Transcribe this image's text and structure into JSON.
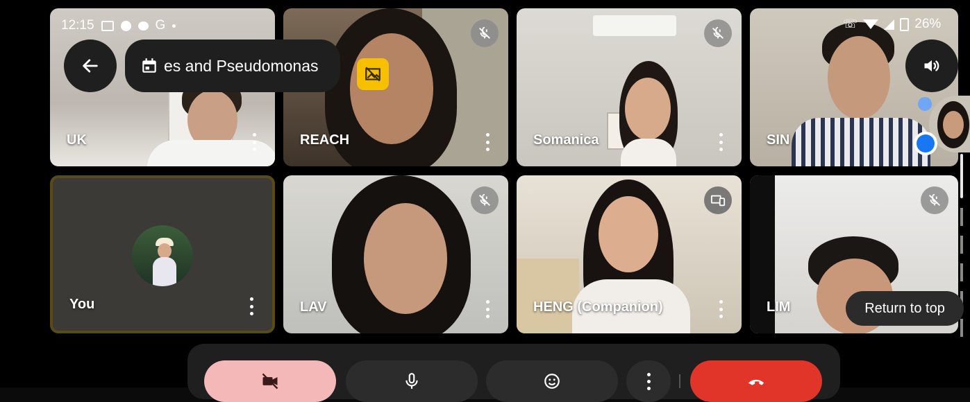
{
  "status_bar": {
    "time": "12:15",
    "battery": "26%",
    "left_icons": [
      "video-icon",
      "messenger-icon",
      "chat-icon",
      "google-icon",
      "dot-icon"
    ],
    "right_icons": [
      "wifi-call-icon",
      "wifi-icon",
      "signal-icon",
      "battery-icon"
    ]
  },
  "meeting": {
    "title": "es and Pseudomonas",
    "calendar_icon": "calendar-icon"
  },
  "tiles": [
    {
      "name": "UK",
      "muted": false
    },
    {
      "name": "REACH",
      "muted": true
    },
    {
      "name": "Somanica",
      "muted": true
    },
    {
      "name": "SIN",
      "muted": false
    },
    {
      "name": "You",
      "muted": false
    },
    {
      "name": "LAV",
      "muted": true
    },
    {
      "name": "HENG (Companion)",
      "muted": false
    },
    {
      "name": "LIM",
      "muted": true
    }
  ],
  "return_to_top": "Return to top",
  "colors": {
    "self_tile_border": "#5a4a16",
    "camera_off_button": "#f4b8b8",
    "end_call_button": "#e2352a",
    "control_button": "#2c2c2c",
    "overlay_badge": "#f6c000",
    "messenger": "#1877f2"
  }
}
